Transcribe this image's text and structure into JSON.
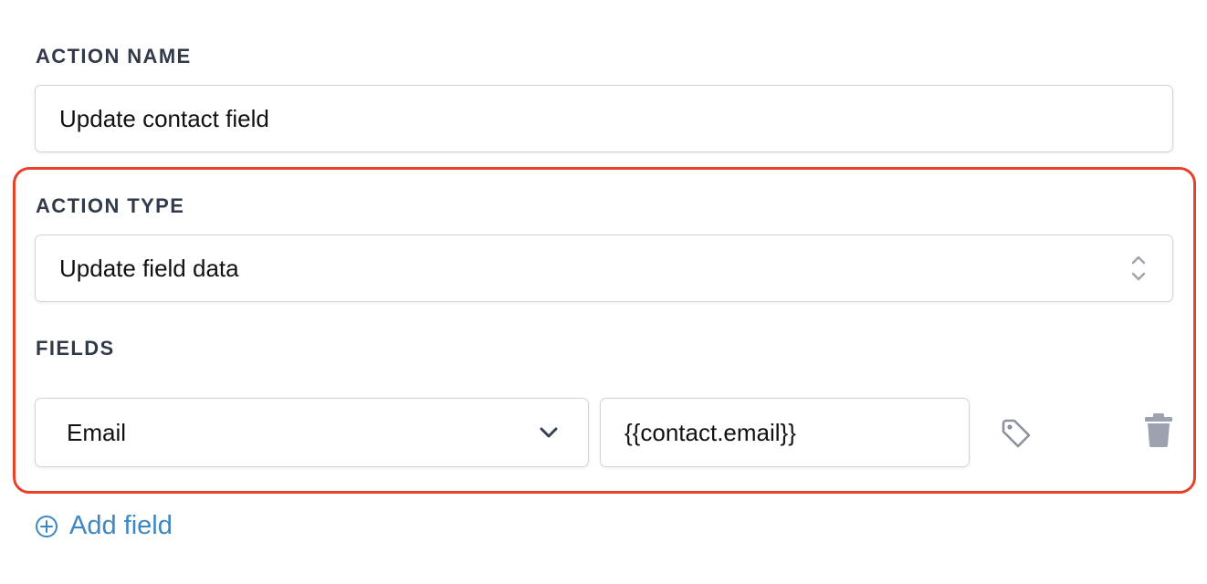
{
  "action_name": {
    "label": "ACTION NAME",
    "value": "Update contact field"
  },
  "action_type": {
    "label": "ACTION TYPE",
    "value": "Update field data"
  },
  "fields": {
    "label": "FIELDS",
    "rows": [
      {
        "field": "Email",
        "value": "{{contact.email}}"
      }
    ]
  },
  "add_field": {
    "label": "Add field"
  },
  "colors": {
    "highlight_border": "#e8412b",
    "link": "#3d87c2",
    "label_text": "#323a4a",
    "icon_gray": "#9ca3af"
  },
  "icons": {
    "stepper": "up-down-chevron-icon",
    "dropdown": "chevron-down-icon",
    "tag": "tag-icon",
    "delete": "trash-icon",
    "add": "plus-circle-icon"
  }
}
